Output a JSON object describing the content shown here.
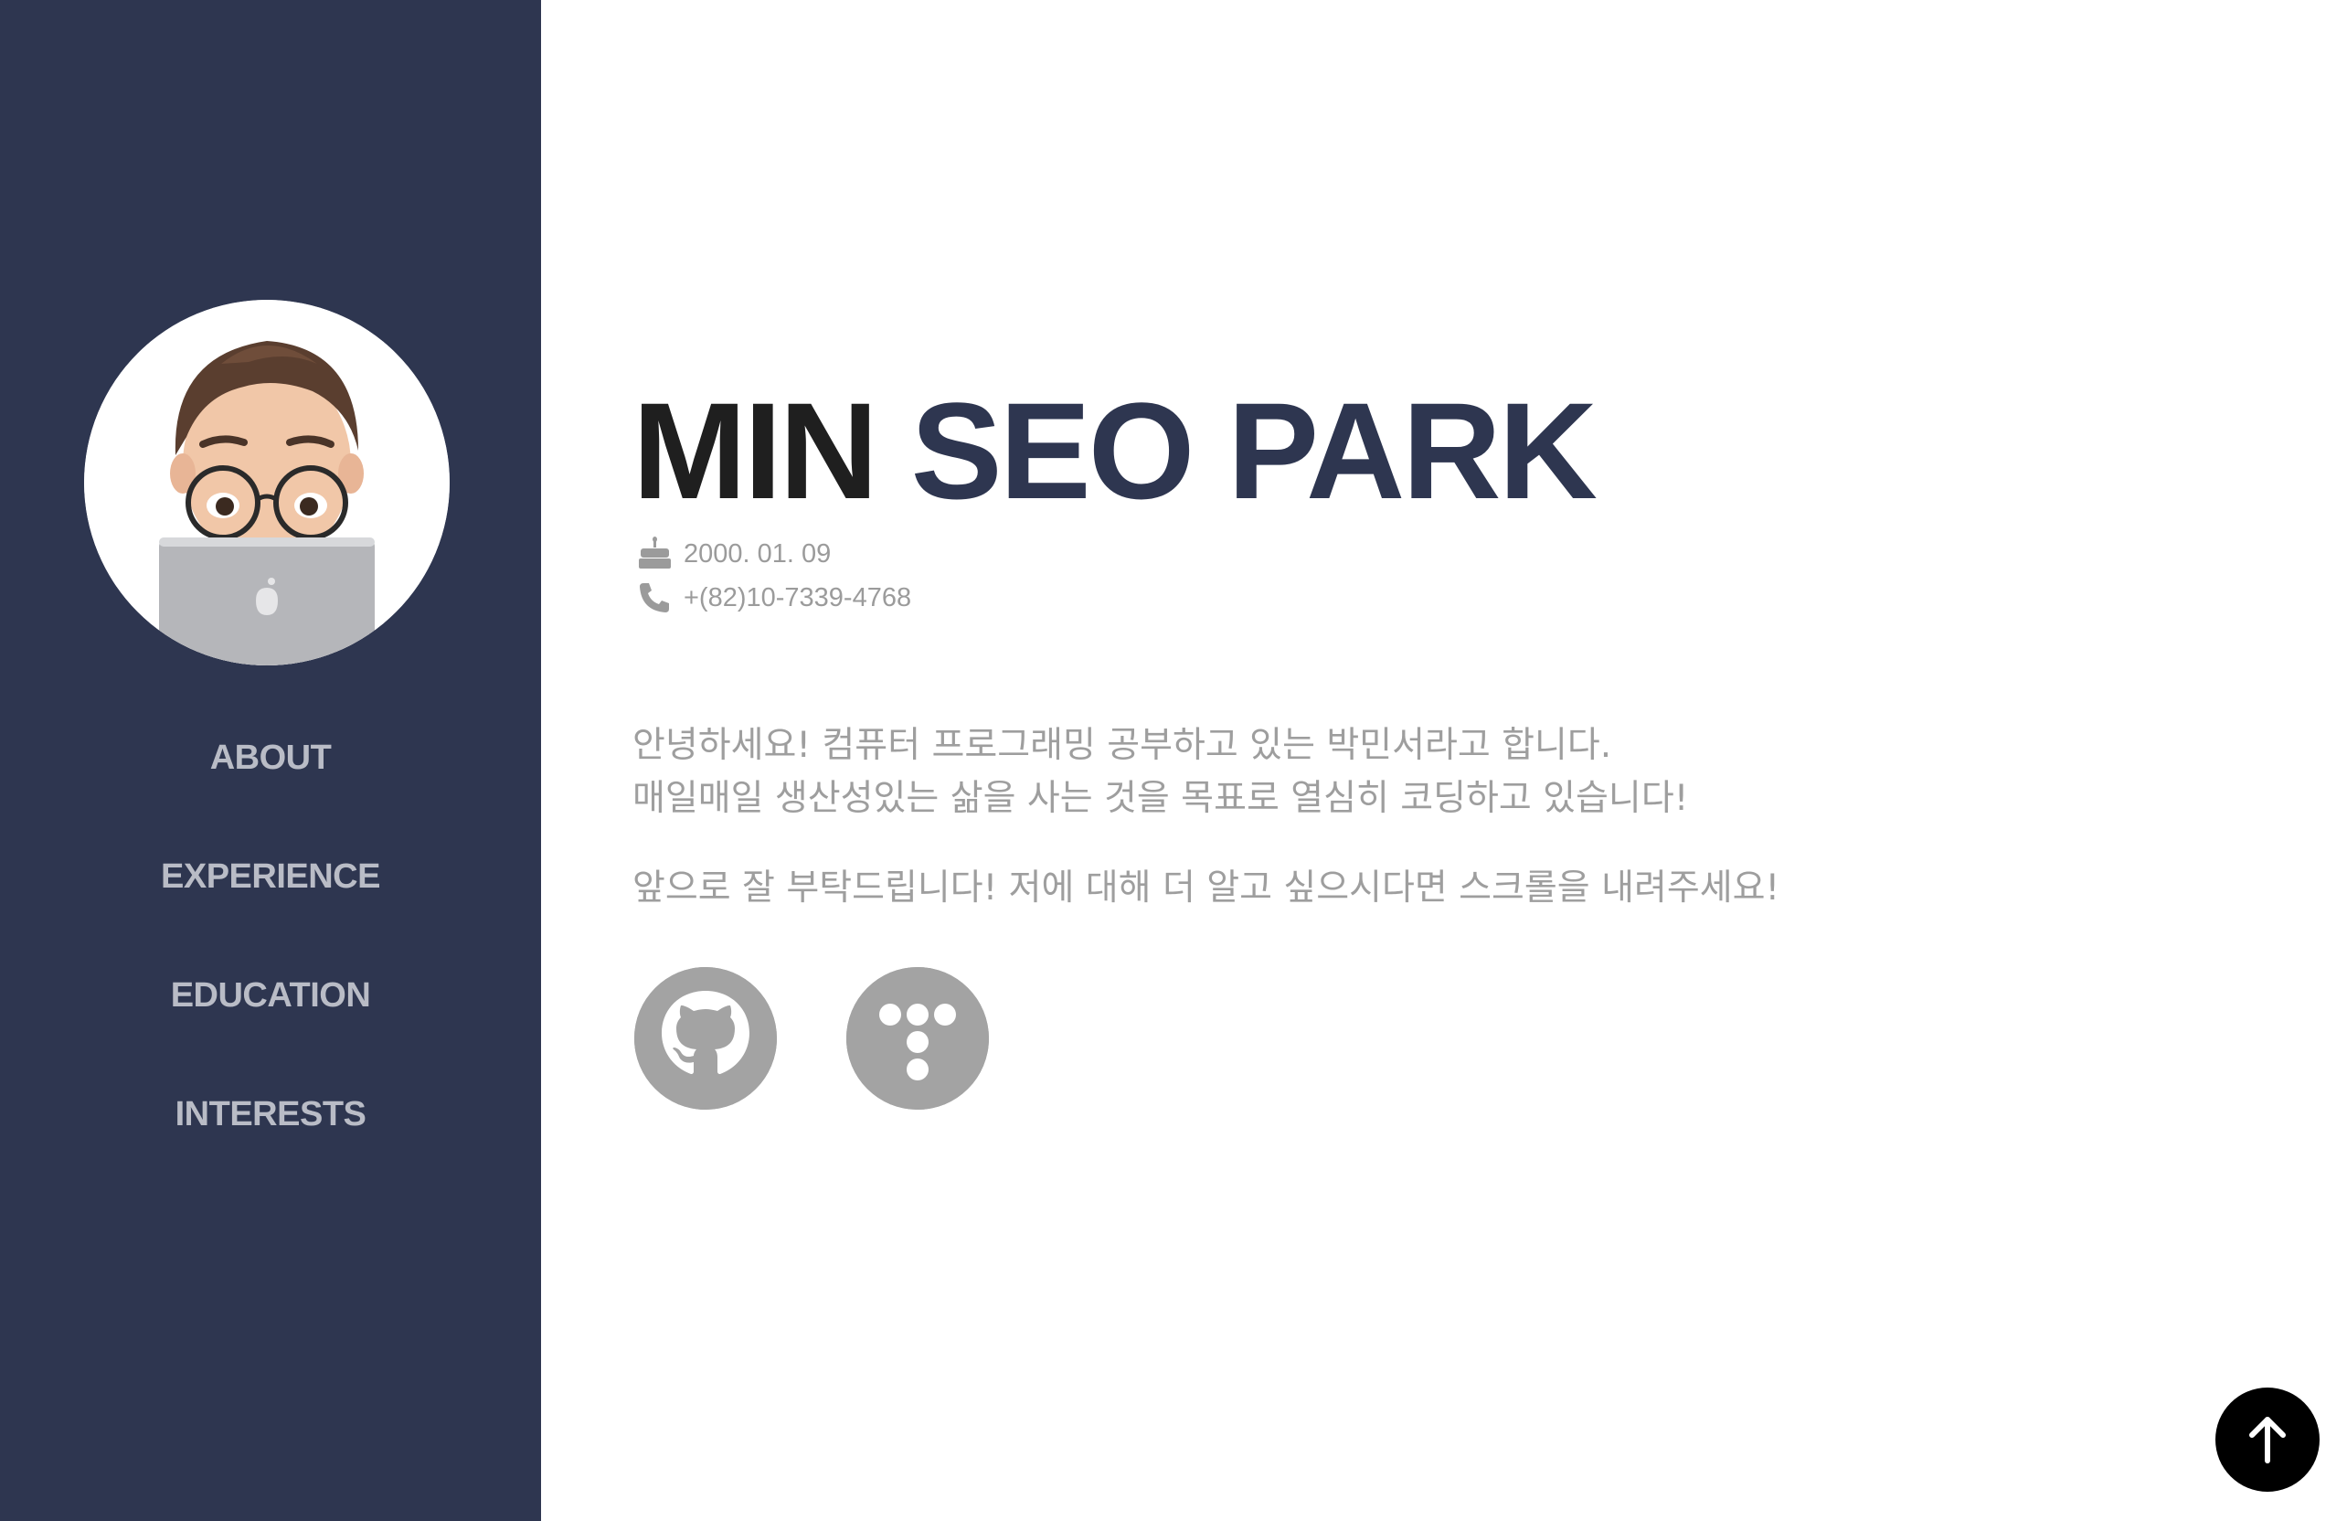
{
  "sidebar": {
    "avatar_icon": "memoji-avatar-with-laptop-icon",
    "nav": [
      {
        "label": "ABOUT"
      },
      {
        "label": "EXPERIENCE"
      },
      {
        "label": "EDUCATION"
      },
      {
        "label": "INTERESTS"
      }
    ]
  },
  "profile": {
    "first_name": "MIN",
    "rest_name": "SEO PARK",
    "birthday": "2000. 01. 09",
    "phone": "+(82)10-7339-4768",
    "birthday_icon": "birthday-cake-icon",
    "phone_icon": "phone-icon"
  },
  "intro": {
    "line1": "안녕하세요! 컴퓨터 프로그래밍 공부하고 있는 박민서라고 합니다.",
    "line2": "매일매일 생산성있는 삶을 사는 것을 목표로 열심히 코딩하고 있습니다!",
    "line3": "앞으로 잘 부탁드립니다! 저에 대해 더 알고 싶으시다면 스크롤을 내려주세요!"
  },
  "social": {
    "github_icon": "github-icon",
    "tistory_icon": "tistory-icon"
  },
  "scroll_top_icon": "arrow-up-icon",
  "colors": {
    "sidebar": "#2e3650",
    "name_accent": "#2e3650",
    "name_dark": "#1f1f1f",
    "muted_text": "#9e9e9e",
    "nav_text": "#b9bcc6",
    "social_bg": "#a3a3a3"
  }
}
